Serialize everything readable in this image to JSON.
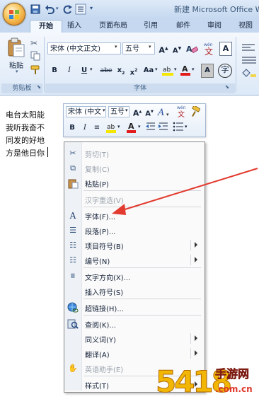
{
  "window": {
    "title": "新建 Microsoft Office W"
  },
  "tabs": [
    "开始",
    "插入",
    "页面布局",
    "引用",
    "邮件",
    "审阅",
    "视图"
  ],
  "ribbon": {
    "clipboard": {
      "paste_label": "粘贴",
      "group_label": "剪贴板"
    },
    "font": {
      "font_name": "宋体 (中文正文)",
      "font_size": "五号",
      "group_label": "字体",
      "highlight_color": "#f5e600",
      "font_color": "#e21b1b"
    }
  },
  "document": {
    "lines": [
      "电台太阳能",
      "我听我奋不",
      "同发的好地",
      "方是他日你"
    ]
  },
  "mini_toolbar": {
    "font_name": "宋体 (中文",
    "font_size": "五号"
  },
  "context_menu": {
    "items": [
      {
        "label": "剪切(T)",
        "icon": "scissors-icon",
        "disabled": true
      },
      {
        "label": "复制(C)",
        "icon": "copy-icon",
        "disabled": true
      },
      {
        "label": "粘贴(P)",
        "icon": "paste-icon",
        "disabled": false
      },
      {
        "label": "汉字重选(V)",
        "icon": "",
        "disabled": true
      },
      {
        "label": "字体(F)...",
        "icon": "font-icon",
        "disabled": false
      },
      {
        "label": "段落(P)...",
        "icon": "paragraph-icon",
        "disabled": false
      },
      {
        "label": "项目符号(B)",
        "icon": "bullets-icon",
        "disabled": false,
        "submenu": true
      },
      {
        "label": "编号(N)",
        "icon": "numbering-icon",
        "disabled": false,
        "submenu": true
      },
      {
        "label": "文字方向(X)...",
        "icon": "text-direction-icon",
        "disabled": false
      },
      {
        "label": "插入符号(S)",
        "icon": "",
        "disabled": false
      },
      {
        "label": "超链接(H)...",
        "icon": "hyperlink-icon",
        "disabled": false
      },
      {
        "label": "查阅(K)...",
        "icon": "lookup-icon",
        "disabled": false
      },
      {
        "label": "同义词(Y)",
        "icon": "",
        "disabled": false,
        "submenu": true
      },
      {
        "label": "翻译(A)",
        "icon": "",
        "disabled": false,
        "submenu": true
      },
      {
        "label": "英语助手(E)",
        "icon": "english-assistant-icon",
        "disabled": true
      },
      {
        "label": "样式(T)",
        "icon": "",
        "disabled": false,
        "submenu": true
      }
    ]
  },
  "watermark": {
    "number": "5418",
    "site_name": "手游网",
    "domain": ".com.cn"
  },
  "colors": {
    "annotation_arrow": "#e23a2e"
  }
}
